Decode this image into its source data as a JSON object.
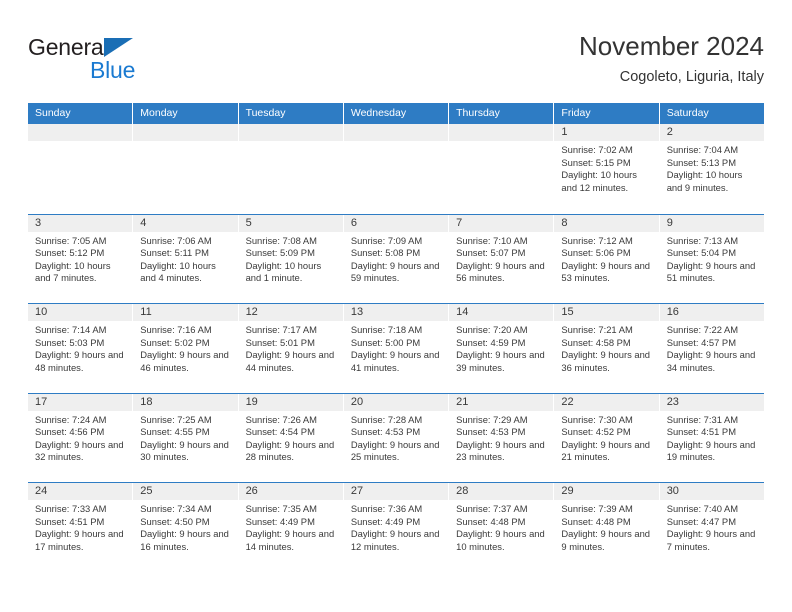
{
  "logo": {
    "word1": "General",
    "word2": "Blue",
    "triangle_color": "#1a6eb5",
    "word2_color": "#1a7ad1"
  },
  "header": {
    "title": "November 2024",
    "subtitle": "Cogoleto, Liguria, Italy"
  },
  "theme": {
    "header_blue": "#2e7cc4",
    "day_band_gray": "#efefef",
    "text": "#3a3a3a"
  },
  "weekday_headers": [
    "Sunday",
    "Monday",
    "Tuesday",
    "Wednesday",
    "Thursday",
    "Friday",
    "Saturday"
  ],
  "labels": {
    "sunrise": "Sunrise:",
    "sunset": "Sunset:",
    "daylight": "Daylight:"
  },
  "weeks": [
    [
      {
        "day": "",
        "empty": true
      },
      {
        "day": "",
        "empty": true
      },
      {
        "day": "",
        "empty": true
      },
      {
        "day": "",
        "empty": true
      },
      {
        "day": "",
        "empty": true
      },
      {
        "day": "1",
        "sunrise": "Sunrise: 7:02 AM",
        "sunset": "Sunset: 5:15 PM",
        "daylight": "Daylight: 10 hours and 12 minutes."
      },
      {
        "day": "2",
        "sunrise": "Sunrise: 7:04 AM",
        "sunset": "Sunset: 5:13 PM",
        "daylight": "Daylight: 10 hours and 9 minutes."
      }
    ],
    [
      {
        "day": "3",
        "sunrise": "Sunrise: 7:05 AM",
        "sunset": "Sunset: 5:12 PM",
        "daylight": "Daylight: 10 hours and 7 minutes."
      },
      {
        "day": "4",
        "sunrise": "Sunrise: 7:06 AM",
        "sunset": "Sunset: 5:11 PM",
        "daylight": "Daylight: 10 hours and 4 minutes."
      },
      {
        "day": "5",
        "sunrise": "Sunrise: 7:08 AM",
        "sunset": "Sunset: 5:09 PM",
        "daylight": "Daylight: 10 hours and 1 minute."
      },
      {
        "day": "6",
        "sunrise": "Sunrise: 7:09 AM",
        "sunset": "Sunset: 5:08 PM",
        "daylight": "Daylight: 9 hours and 59 minutes."
      },
      {
        "day": "7",
        "sunrise": "Sunrise: 7:10 AM",
        "sunset": "Sunset: 5:07 PM",
        "daylight": "Daylight: 9 hours and 56 minutes."
      },
      {
        "day": "8",
        "sunrise": "Sunrise: 7:12 AM",
        "sunset": "Sunset: 5:06 PM",
        "daylight": "Daylight: 9 hours and 53 minutes."
      },
      {
        "day": "9",
        "sunrise": "Sunrise: 7:13 AM",
        "sunset": "Sunset: 5:04 PM",
        "daylight": "Daylight: 9 hours and 51 minutes."
      }
    ],
    [
      {
        "day": "10",
        "sunrise": "Sunrise: 7:14 AM",
        "sunset": "Sunset: 5:03 PM",
        "daylight": "Daylight: 9 hours and 48 minutes."
      },
      {
        "day": "11",
        "sunrise": "Sunrise: 7:16 AM",
        "sunset": "Sunset: 5:02 PM",
        "daylight": "Daylight: 9 hours and 46 minutes."
      },
      {
        "day": "12",
        "sunrise": "Sunrise: 7:17 AM",
        "sunset": "Sunset: 5:01 PM",
        "daylight": "Daylight: 9 hours and 44 minutes."
      },
      {
        "day": "13",
        "sunrise": "Sunrise: 7:18 AM",
        "sunset": "Sunset: 5:00 PM",
        "daylight": "Daylight: 9 hours and 41 minutes."
      },
      {
        "day": "14",
        "sunrise": "Sunrise: 7:20 AM",
        "sunset": "Sunset: 4:59 PM",
        "daylight": "Daylight: 9 hours and 39 minutes."
      },
      {
        "day": "15",
        "sunrise": "Sunrise: 7:21 AM",
        "sunset": "Sunset: 4:58 PM",
        "daylight": "Daylight: 9 hours and 36 minutes."
      },
      {
        "day": "16",
        "sunrise": "Sunrise: 7:22 AM",
        "sunset": "Sunset: 4:57 PM",
        "daylight": "Daylight: 9 hours and 34 minutes."
      }
    ],
    [
      {
        "day": "17",
        "sunrise": "Sunrise: 7:24 AM",
        "sunset": "Sunset: 4:56 PM",
        "daylight": "Daylight: 9 hours and 32 minutes."
      },
      {
        "day": "18",
        "sunrise": "Sunrise: 7:25 AM",
        "sunset": "Sunset: 4:55 PM",
        "daylight": "Daylight: 9 hours and 30 minutes."
      },
      {
        "day": "19",
        "sunrise": "Sunrise: 7:26 AM",
        "sunset": "Sunset: 4:54 PM",
        "daylight": "Daylight: 9 hours and 28 minutes."
      },
      {
        "day": "20",
        "sunrise": "Sunrise: 7:28 AM",
        "sunset": "Sunset: 4:53 PM",
        "daylight": "Daylight: 9 hours and 25 minutes."
      },
      {
        "day": "21",
        "sunrise": "Sunrise: 7:29 AM",
        "sunset": "Sunset: 4:53 PM",
        "daylight": "Daylight: 9 hours and 23 minutes."
      },
      {
        "day": "22",
        "sunrise": "Sunrise: 7:30 AM",
        "sunset": "Sunset: 4:52 PM",
        "daylight": "Daylight: 9 hours and 21 minutes."
      },
      {
        "day": "23",
        "sunrise": "Sunrise: 7:31 AM",
        "sunset": "Sunset: 4:51 PM",
        "daylight": "Daylight: 9 hours and 19 minutes."
      }
    ],
    [
      {
        "day": "24",
        "sunrise": "Sunrise: 7:33 AM",
        "sunset": "Sunset: 4:51 PM",
        "daylight": "Daylight: 9 hours and 17 minutes."
      },
      {
        "day": "25",
        "sunrise": "Sunrise: 7:34 AM",
        "sunset": "Sunset: 4:50 PM",
        "daylight": "Daylight: 9 hours and 16 minutes."
      },
      {
        "day": "26",
        "sunrise": "Sunrise: 7:35 AM",
        "sunset": "Sunset: 4:49 PM",
        "daylight": "Daylight: 9 hours and 14 minutes."
      },
      {
        "day": "27",
        "sunrise": "Sunrise: 7:36 AM",
        "sunset": "Sunset: 4:49 PM",
        "daylight": "Daylight: 9 hours and 12 minutes."
      },
      {
        "day": "28",
        "sunrise": "Sunrise: 7:37 AM",
        "sunset": "Sunset: 4:48 PM",
        "daylight": "Daylight: 9 hours and 10 minutes."
      },
      {
        "day": "29",
        "sunrise": "Sunrise: 7:39 AM",
        "sunset": "Sunset: 4:48 PM",
        "daylight": "Daylight: 9 hours and 9 minutes."
      },
      {
        "day": "30",
        "sunrise": "Sunrise: 7:40 AM",
        "sunset": "Sunset: 4:47 PM",
        "daylight": "Daylight: 9 hours and 7 minutes."
      }
    ]
  ]
}
